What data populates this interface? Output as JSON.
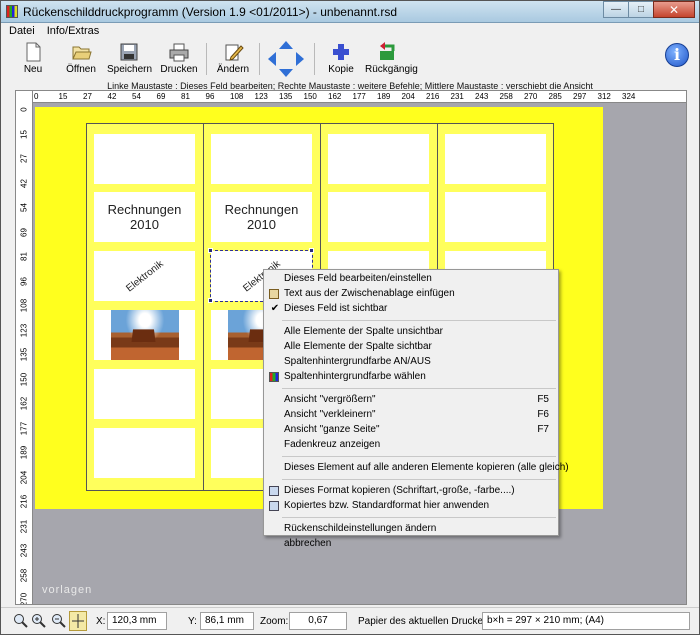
{
  "window": {
    "title": "Rückenschilddruckprogramm (Version 1.9 <01/2011>) - unbenannt.rsd",
    "minimize": "—",
    "maximize": "□",
    "close": "✕"
  },
  "menu": [
    "Datei",
    "Info/Extras"
  ],
  "toolbar": {
    "neu": "Neu",
    "oeffnen": "Öffnen",
    "speichern": "Speichern",
    "drucken": "Drucken",
    "aendern": "Ändern",
    "kopie": "Kopie",
    "rueckgaengig": "Rückgängig",
    "info_icon_text": "i"
  },
  "hint": "Linke Maustaste : Dieses Feld bearbeiten;  Rechte Maustaste : weitere Befehle;  Mittlere Maustaste : verschiebt die Ansicht",
  "ruler": {
    "top": [
      "0",
      "15",
      "27",
      "42",
      "54",
      "69",
      "81",
      "96",
      "108",
      "123",
      "135",
      "150",
      "162",
      "177",
      "189",
      "204",
      "216",
      "231",
      "243",
      "258",
      "270",
      "285",
      "297",
      "312",
      "324"
    ],
    "left": [
      "0",
      "15",
      "27",
      "42",
      "54",
      "69",
      "81",
      "96",
      "108",
      "123",
      "135",
      "150",
      "162",
      "177",
      "189",
      "204",
      "216",
      "231",
      "243",
      "258",
      "270",
      "285",
      "297"
    ]
  },
  "labels": {
    "col1_row2": "Rechnungen\n2010",
    "col2_row2": "Rechnungen\n2010",
    "col1_row3": "Elektronik",
    "col2_row3": "Elektronik"
  },
  "context_menu": [
    {
      "label": "Dieses Feld bearbeiten/einstellen",
      "key": "",
      "mark": ""
    },
    {
      "label": "Text aus der Zwischenablage einfügen",
      "key": "",
      "mark": "clipboard"
    },
    {
      "label": "Dieses Feld ist sichtbar",
      "key": "",
      "mark": "check"
    },
    {
      "label": "Alle Elemente der Spalte unsichtbar",
      "key": "",
      "mark": ""
    },
    {
      "label": "Alle Elemente der Spalte sichtbar",
      "key": "",
      "mark": ""
    },
    {
      "label": "Spaltenhintergrundfarbe AN/AUS",
      "key": "",
      "mark": ""
    },
    {
      "label": "Spaltenhintergrundfarbe wählen",
      "key": "",
      "mark": "palette"
    },
    {
      "label": "Ansicht \"vergrößern\"",
      "key": "F5",
      "mark": ""
    },
    {
      "label": "Ansicht \"verkleinern\"",
      "key": "F6",
      "mark": ""
    },
    {
      "label": "Ansicht \"ganze Seite\"",
      "key": "F7",
      "mark": ""
    },
    {
      "label": "Fadenkreuz anzeigen",
      "key": "",
      "mark": ""
    },
    {
      "label": "Dieses Element auf alle anderen Elemente kopieren (alle gleich)",
      "key": "",
      "mark": ""
    },
    {
      "label": "Dieses Format kopieren (Schriftart,-große, -farbe....)",
      "key": "",
      "mark": "copy"
    },
    {
      "label": "Kopiertes bzw. Standardformat hier anwenden",
      "key": "",
      "mark": "paste"
    },
    {
      "label": "Rückenschildeinstellungen ändern",
      "key": "",
      "mark": ""
    },
    {
      "label": "abbrechen",
      "key": "",
      "mark": ""
    }
  ],
  "watermark": "vorlagen",
  "status": {
    "x_label": "X:",
    "x_value": "120,3 mm",
    "y_label": "Y:",
    "y_value": "86,1 mm",
    "zoom_label": "Zoom:",
    "zoom_value": "0,67",
    "printer_label": "Papier des aktuellen Druckers :",
    "printer_value": "b×h = 297 × 210 mm; (A4)"
  },
  "colors": {
    "paper": "#ffff1e",
    "workspace": "#a6a6ad",
    "accent_blue": "#2f6fd6"
  }
}
